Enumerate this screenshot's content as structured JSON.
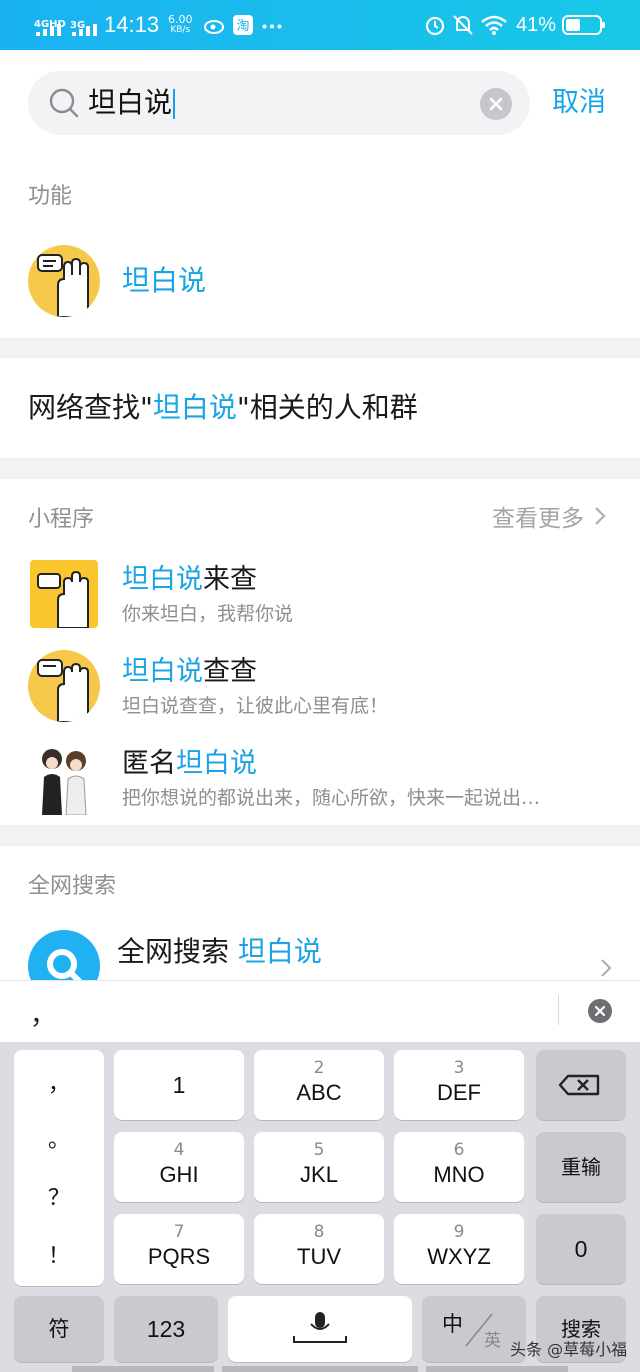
{
  "status_bar": {
    "network_a": "4GHD",
    "network_b": "3G",
    "time": "14:13",
    "speed_value": "6.00",
    "speed_unit": "KB/s",
    "battery": "41%"
  },
  "search": {
    "query": "坦白说",
    "cancel_label": "取消"
  },
  "function_section": {
    "title": "功能",
    "item_label": "坦白说"
  },
  "network_find": {
    "prefix": "网络查找\"",
    "highlight": "坦白说",
    "suffix": "\"相关的人和群"
  },
  "mini_programs": {
    "title": "小程序",
    "more_label": "查看更多",
    "items": [
      {
        "title_hl": "坦白说",
        "title_rest": "来查",
        "desc": "你来坦白，我帮你说"
      },
      {
        "title_hl": "坦白说",
        "title_rest": "查查",
        "desc": "坦白说查查，让彼此心里有底！"
      },
      {
        "title_pre": "匿名",
        "title_hl": "坦白说",
        "desc": "把你想说的都说出来，随心所欲，快来一起说出…"
      }
    ]
  },
  "web_search": {
    "title": "全网搜索",
    "label": "全网搜索",
    "query": "坦白说"
  },
  "candidate_bar": {
    "text": "，"
  },
  "keyboard": {
    "punct": [
      "，",
      "。",
      "？",
      "！"
    ],
    "keys": [
      {
        "num": "",
        "letters": "1"
      },
      {
        "num": "2",
        "letters": "ABC"
      },
      {
        "num": "3",
        "letters": "DEF"
      },
      {
        "num": "4",
        "letters": "GHI"
      },
      {
        "num": "5",
        "letters": "JKL"
      },
      {
        "num": "6",
        "letters": "MNO"
      },
      {
        "num": "7",
        "letters": "PQRS"
      },
      {
        "num": "8",
        "letters": "TUV"
      },
      {
        "num": "9",
        "letters": "WXYZ"
      }
    ],
    "reenter_label": "重输",
    "zero_label": "0",
    "symbol_label": "符",
    "numeric_label": "123",
    "lang_cn": "中",
    "lang_en": "英",
    "search_label": "搜索"
  },
  "watermark": "头条 @草莓小福",
  "colors": {
    "accent": "#1ba4e5",
    "status_bar": "#1ab2f2",
    "avatar_yellow": "#f6c84a"
  }
}
